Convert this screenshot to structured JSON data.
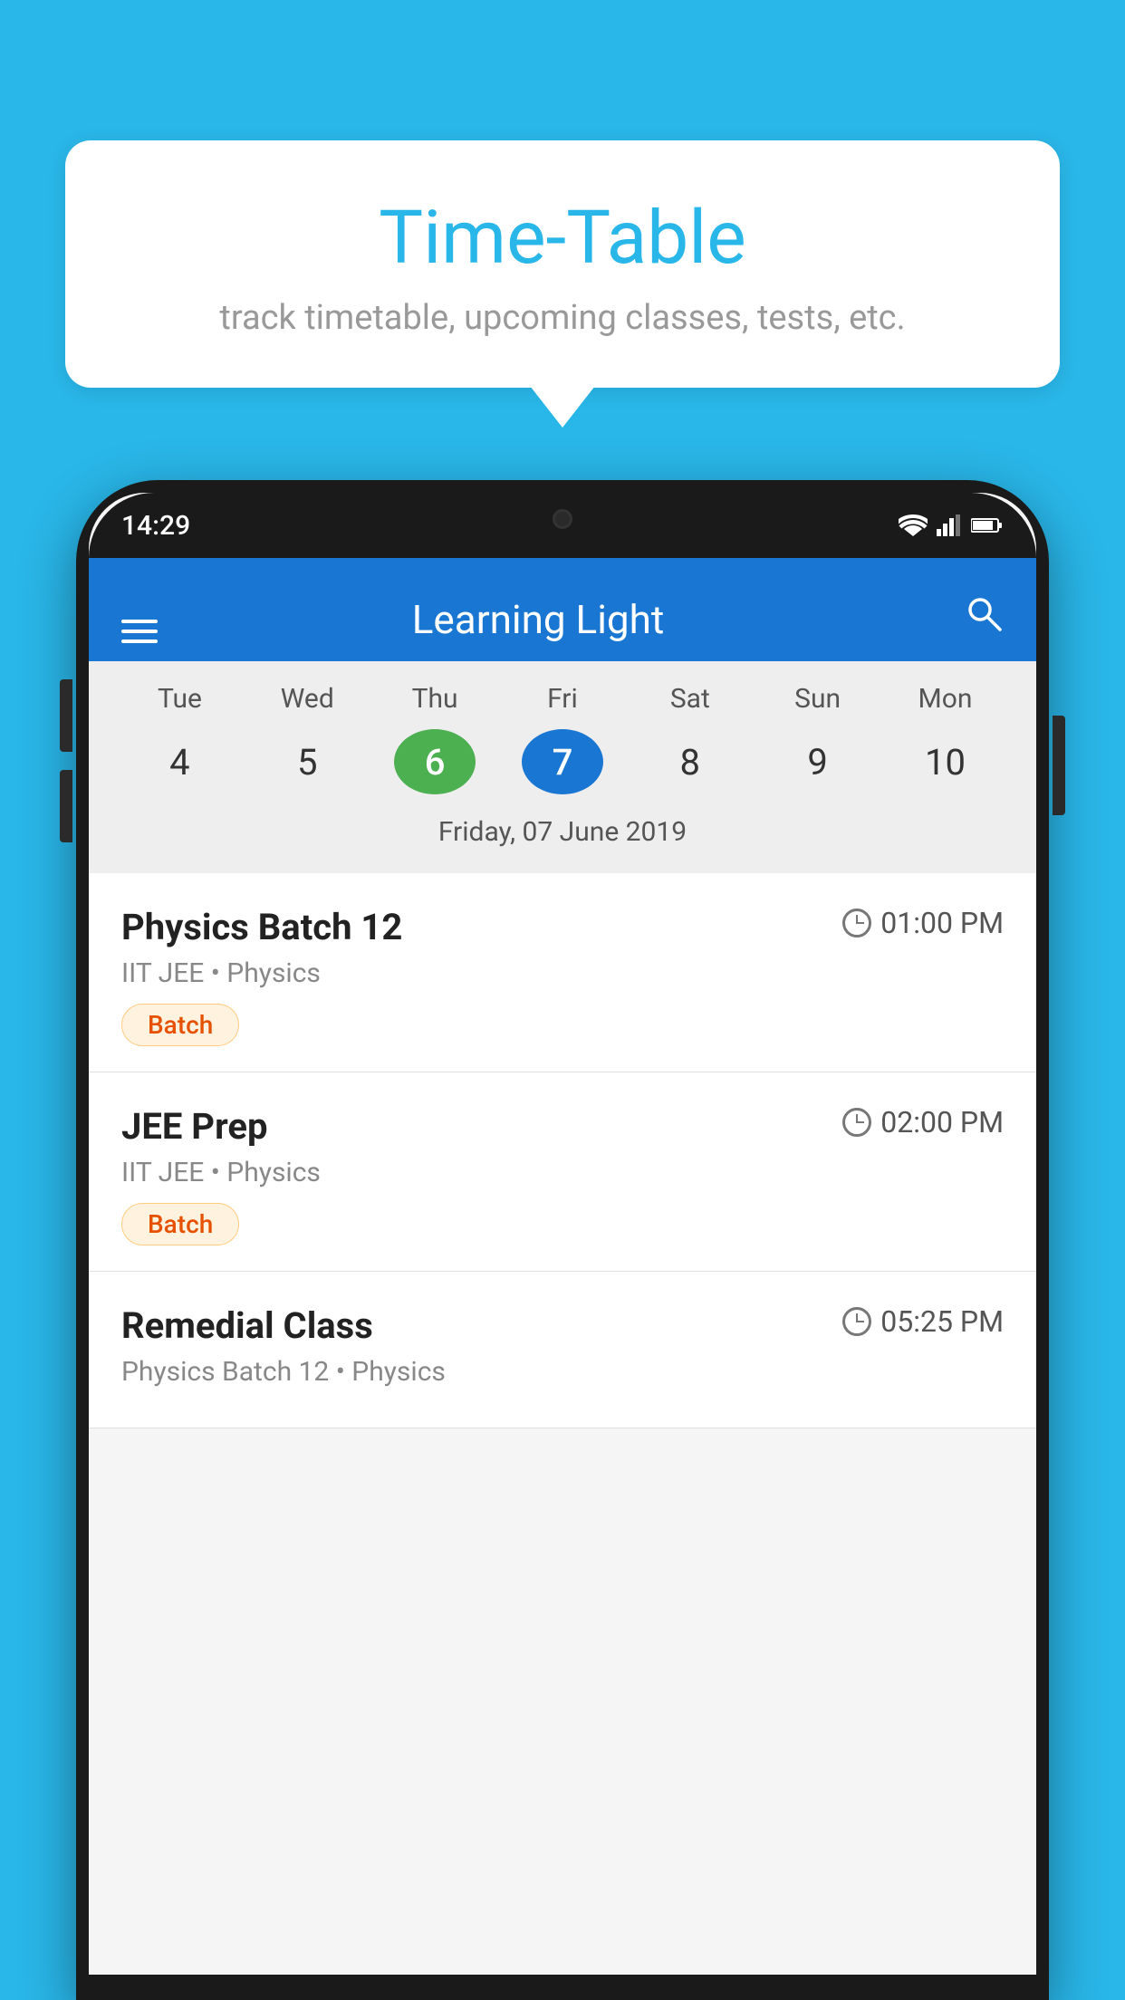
{
  "background_color": "#29b6e8",
  "speech_bubble": {
    "title": "Time-Table",
    "subtitle": "track timetable, upcoming classes, tests, etc."
  },
  "app": {
    "name": "Learning Light",
    "status_bar": {
      "time": "14:29"
    }
  },
  "calendar": {
    "days": [
      {
        "label": "Tue",
        "number": "4",
        "state": "normal"
      },
      {
        "label": "Wed",
        "number": "5",
        "state": "normal"
      },
      {
        "label": "Thu",
        "number": "6",
        "state": "today"
      },
      {
        "label": "Fri",
        "number": "7",
        "state": "selected"
      },
      {
        "label": "Sat",
        "number": "8",
        "state": "normal"
      },
      {
        "label": "Sun",
        "number": "9",
        "state": "normal"
      },
      {
        "label": "Mon",
        "number": "10",
        "state": "normal"
      }
    ],
    "selected_date": "Friday, 07 June 2019"
  },
  "schedule": [
    {
      "title": "Physics Batch 12",
      "time": "01:00 PM",
      "subtitle": "IIT JEE • Physics",
      "badge": "Batch"
    },
    {
      "title": "JEE Prep",
      "time": "02:00 PM",
      "subtitle": "IIT JEE • Physics",
      "badge": "Batch"
    },
    {
      "title": "Remedial Class",
      "time": "05:25 PM",
      "subtitle": "Physics Batch 12 • Physics",
      "badge": ""
    }
  ]
}
